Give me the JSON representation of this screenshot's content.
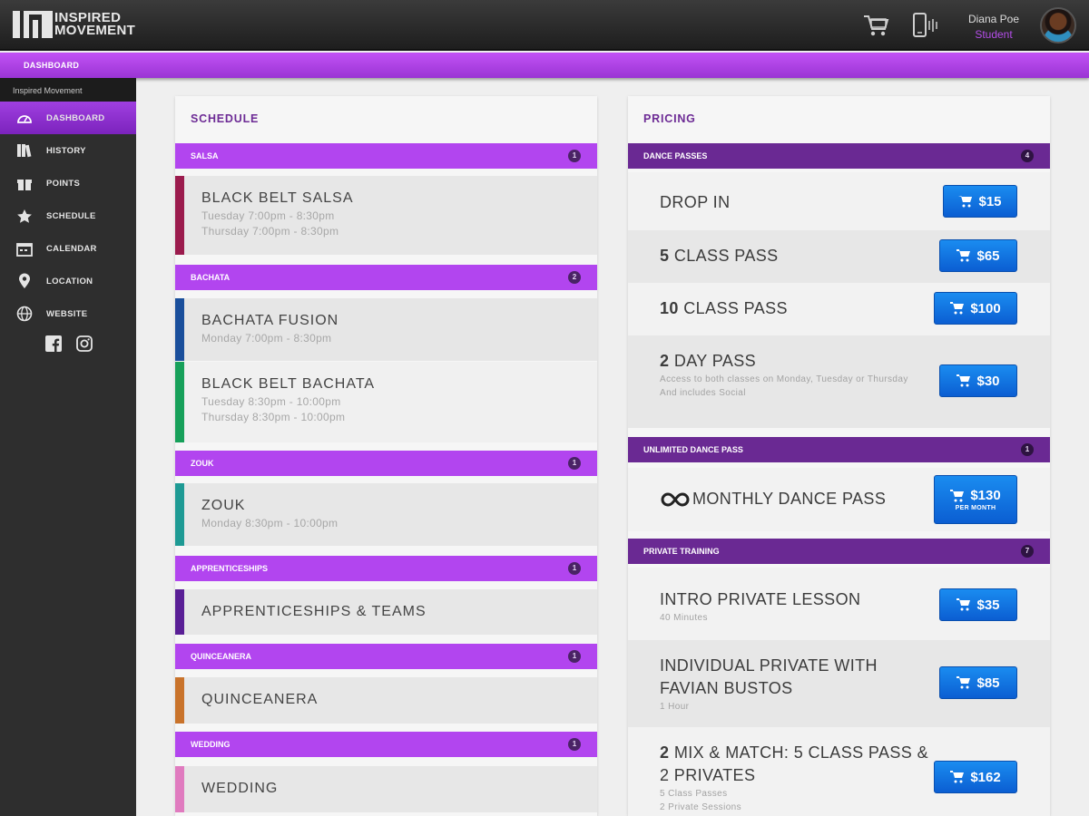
{
  "header": {
    "logo_line1": "INSPIRED",
    "logo_line2": "MOVEMENT",
    "user_name": "Diana Poe",
    "user_role": "Student",
    "cart_icon": "cart-icon",
    "device_icon": "phone-vibrate-icon"
  },
  "breadcrumb": {
    "label": "DASHBOARD"
  },
  "sidebar": {
    "title": "Inspired Movement",
    "items": [
      {
        "label": "DASHBOARD",
        "icon": "dashboard-icon"
      },
      {
        "label": "HISTORY",
        "icon": "books-icon"
      },
      {
        "label": "POINTS",
        "icon": "gift-icon"
      },
      {
        "label": "SCHEDULE",
        "icon": "star-icon"
      },
      {
        "label": "CALENDAR",
        "icon": "calendar-icon"
      },
      {
        "label": "LOCATION",
        "icon": "map-pin-icon"
      },
      {
        "label": "WEBSITE",
        "icon": "globe-icon"
      }
    ],
    "social": [
      "facebook-icon",
      "instagram-icon"
    ]
  },
  "schedule": {
    "title": "SCHEDULE",
    "sections": [
      {
        "name": "SALSA",
        "count": "1",
        "items": [
          {
            "name": "BLACK BELT SALSA",
            "color": "#9b1b4d",
            "times": [
              "Tuesday  7:00pm - 8:30pm",
              "Thursday  7:00pm - 8:30pm"
            ]
          }
        ]
      },
      {
        "name": "BACHATA",
        "count": "2",
        "items": [
          {
            "name": "BACHATA FUSION",
            "color": "#1a4f9c",
            "times": [
              "Monday  7:00pm - 8:30pm"
            ]
          },
          {
            "name": "BLACK BELT BACHATA",
            "color": "#17a05a",
            "times": [
              "Tuesday  8:30pm - 10:00pm",
              "Thursday  8:30pm - 10:00pm"
            ]
          }
        ]
      },
      {
        "name": "ZOUK",
        "count": "1",
        "items": [
          {
            "name": "ZOUK",
            "color": "#1e9a94",
            "times": [
              "Monday  8:30pm - 10:00pm"
            ]
          }
        ]
      },
      {
        "name": "APPRENTICESHIPS",
        "count": "1",
        "items": [
          {
            "name": "APPRENTICESHIPS & TEAMS",
            "color": "#5a1f96",
            "times": []
          }
        ]
      },
      {
        "name": "QUINCEANERA",
        "count": "1",
        "items": [
          {
            "name": "QUINCEANERA",
            "color": "#c9732b",
            "times": []
          }
        ]
      },
      {
        "name": "WEDDING",
        "count": "1",
        "items": [
          {
            "name": "WEDDING",
            "color": "#e07bbf",
            "times": []
          }
        ]
      }
    ]
  },
  "pricing": {
    "title": "PRICING",
    "sections": [
      {
        "name": "DANCE PASSES",
        "count": "4",
        "items": [
          {
            "name_bold": "",
            "name": "DROP IN",
            "sub": [],
            "price": "$15",
            "per": ""
          },
          {
            "name_bold": "5",
            "name": " CLASS PASS",
            "sub": [],
            "price": "$65",
            "per": ""
          },
          {
            "name_bold": "10",
            "name": " CLASS PASS",
            "sub": [],
            "price": "$100",
            "per": ""
          },
          {
            "name_bold": "2",
            "name": " DAY PASS",
            "sub": [
              "Access to both classes on Monday, Tuesday or Thursday",
              "And includes Social"
            ],
            "price": "$30",
            "per": ""
          }
        ]
      },
      {
        "name": "UNLIMITED DANCE PASS",
        "count": "1",
        "items": [
          {
            "name_bold": "",
            "name": "MONTHLY DANCE PASS",
            "sub": [],
            "price": "$130",
            "per": "PER MONTH",
            "icon": "infinity-icon"
          }
        ]
      },
      {
        "name": "PRIVATE TRAINING",
        "count": "7",
        "items": [
          {
            "name_bold": "",
            "name": "INTRO PRIVATE LESSON",
            "sub": [
              "40 Minutes"
            ],
            "price": "$35",
            "per": ""
          },
          {
            "name_bold": "",
            "name": "INDIVIDUAL PRIVATE WITH FAVIAN BUSTOS",
            "sub": [
              "1 Hour"
            ],
            "price": "$85",
            "per": ""
          },
          {
            "name_bold": "2",
            "name": " MIX & MATCH: 5 CLASS PASS & 2 PRIVATES",
            "sub": [
              "5 Class Passes",
              "2 Private Sessions"
            ],
            "price": "$162",
            "per": ""
          }
        ]
      }
    ]
  }
}
